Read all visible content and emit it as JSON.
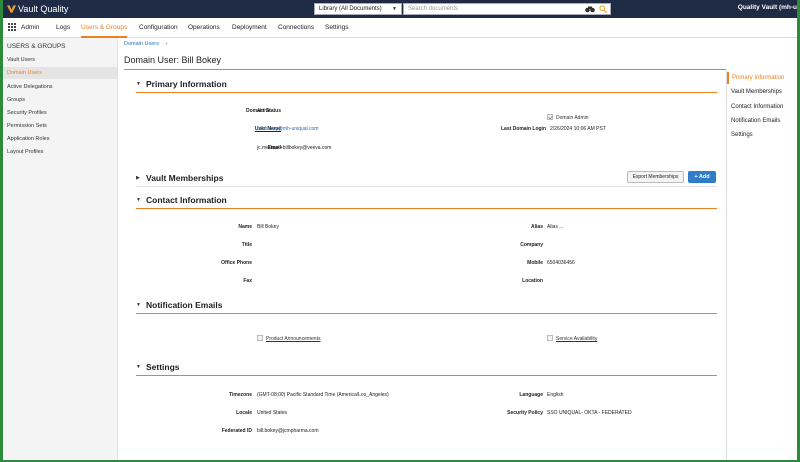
{
  "app": {
    "logo_text": "Vault Quality",
    "library_select": "Library (All Documents)",
    "search_placeholder": "Search documents",
    "vault_name": "Quality Vault (mh-u"
  },
  "nav": {
    "items": [
      "Admin",
      "Logs",
      "Users & Groups",
      "Configuration",
      "Operations",
      "Deployment",
      "Connections",
      "Settings"
    ],
    "active": "Users & Groups"
  },
  "sidebar": {
    "title": "USERS & GROUPS",
    "items": [
      "Vault Users",
      "Domain Users",
      "Active Delegations",
      "Groups",
      "Security Profiles",
      "Permission Sets",
      "Application Roles",
      "Layout Profiles"
    ],
    "active": "Domain Users"
  },
  "breadcrumb": {
    "label": "Domain Users",
    "sep": "›"
  },
  "page_title": "Domain User: Bill Bokey",
  "primary": {
    "title": "Primary Information",
    "domain_status_label": "Domain Status",
    "domain_status": "Active",
    "domain_admin_label": "Domain Admin",
    "domain_admin_checked": true,
    "user_name_label": "User Name",
    "user_name": "bill.bokey@mh-uniqual.com",
    "last_login_label": "Last Domain Login",
    "last_login": "2/26/2024 10:06 AM PST",
    "email_label": "Email",
    "email": "jc.merlaux+billbokey@veeva.com"
  },
  "memberships": {
    "title": "Vault Memberships",
    "export_label": "Export Memberships",
    "add_label": "+ Add"
  },
  "contact": {
    "title": "Contact Information",
    "name_label": "Name",
    "name": "Bill Bokey",
    "alias_label": "Alias",
    "alias": "Alias ...",
    "title_label": "Title",
    "company_label": "Company",
    "office_phone_label": "Office Phone",
    "mobile_label": "Mobile",
    "mobile": "6504036456",
    "fax_label": "Fax",
    "location_label": "Location"
  },
  "notifications": {
    "title": "Notification Emails",
    "product_label": "Product Announcements",
    "service_label": "Service Availability"
  },
  "settings": {
    "title": "Settings",
    "timezone_label": "Timezone",
    "timezone": "(GMT-08:00) Pacific Standard Time (America/Los_Angeles)",
    "language_label": "Language",
    "language": "English",
    "locale_label": "Locale",
    "locale": "United States",
    "security_policy_label": "Security Policy",
    "security_policy": "SSO UNIQUAL- OKTA - FEDERATED",
    "federated_label": "Federated ID",
    "federated": "bill.bokey@jcmpharma.com"
  },
  "toc": {
    "items": [
      "Primary Information",
      "Vault Memberships",
      "Contact Information",
      "Notification Emails",
      "Settings"
    ],
    "active": "Primary Information"
  },
  "colors": {
    "accent": "#e9821e",
    "topbar": "#1f2a44",
    "link": "#2a6ebb",
    "button": "#2f7cc9"
  }
}
